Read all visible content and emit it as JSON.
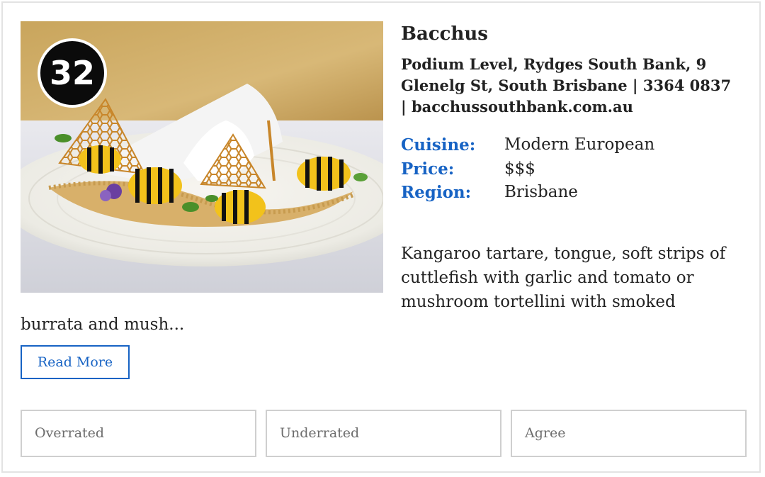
{
  "restaurant": {
    "rank": "32",
    "name": "Bacchus",
    "address": "Podium Level, Rydges South Bank, 9 Glenelg St, South Brisbane | 3364 0837 | bacchussouthbank.com.au",
    "photo_icon": "dessert-photo"
  },
  "meta": [
    {
      "key": "Cuisine:",
      "value": "Modern European"
    },
    {
      "key": "Price:",
      "value": "$$$"
    },
    {
      "key": "Region:",
      "value": "Brisbane"
    }
  ],
  "description": {
    "part1": "Kangaroo tartare, tongue, soft strips of cuttlefish with garlic and tomato or mushroom tortellini with smoked",
    "part2": "burrata and mush..."
  },
  "read_more_label": "Read More",
  "votes": [
    {
      "label": "Overrated"
    },
    {
      "label": "Underrated"
    },
    {
      "label": "Agree"
    }
  ],
  "colors": {
    "accent": "#1763c4",
    "border": "#cfcfcf",
    "badge": "#0b0b0b"
  }
}
